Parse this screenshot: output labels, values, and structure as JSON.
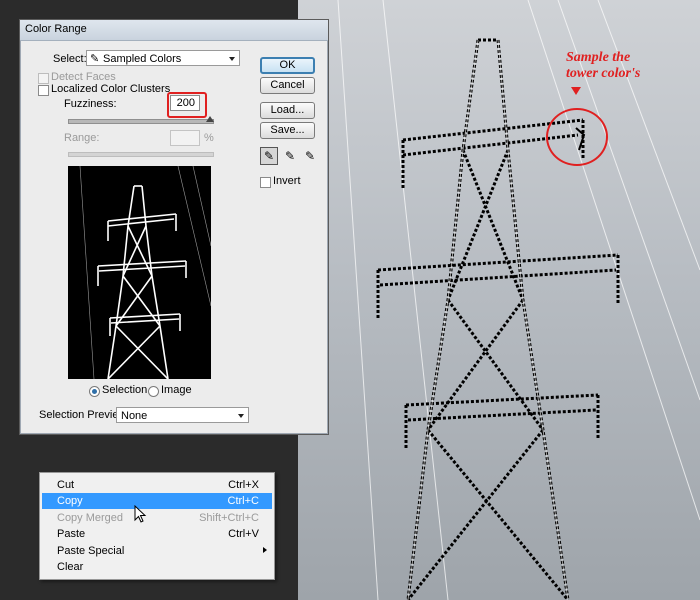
{
  "annotation": {
    "line1": "Sample the",
    "line2": "tower color's"
  },
  "dialog": {
    "title": "Color Range",
    "select_label": "Select:",
    "select_value": "Sampled Colors",
    "detect_faces": "Detect Faces",
    "localized_clusters": "Localized Color Clusters",
    "fuzziness_label": "Fuzziness:",
    "fuzziness_value": "200",
    "range_label": "Range:",
    "range_unit": "%",
    "buttons": {
      "ok": "OK",
      "cancel": "Cancel",
      "load": "Load...",
      "save": "Save..."
    },
    "invert": "Invert",
    "radio_selection": "Selection",
    "radio_image": "Image",
    "preview_label": "Selection Preview:",
    "preview_value": "None"
  },
  "context_menu": {
    "items": [
      {
        "label": "Cut",
        "shortcut": "Ctrl+X"
      },
      {
        "label": "Copy",
        "shortcut": "Ctrl+C"
      },
      {
        "label": "Copy Merged",
        "shortcut": "Shift+Ctrl+C"
      },
      {
        "label": "Paste",
        "shortcut": "Ctrl+V"
      },
      {
        "label": "Paste Special",
        "shortcut": ""
      },
      {
        "label": "Clear",
        "shortcut": ""
      }
    ]
  },
  "colors": {
    "highlight": "#3399ff",
    "annotation": "#e02020",
    "default_button_border": "#3c7fb1"
  }
}
